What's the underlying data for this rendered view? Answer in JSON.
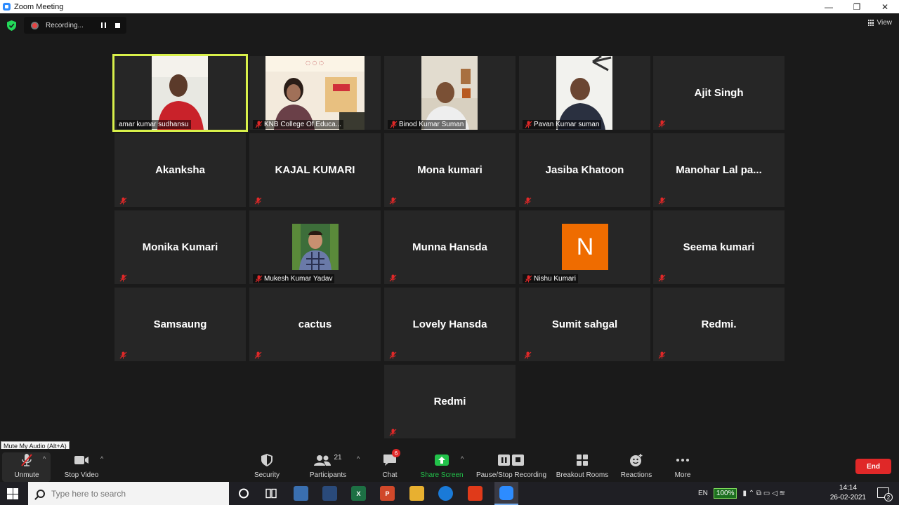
{
  "window": {
    "title": "Zoom Meeting",
    "controls": [
      "—",
      "❐",
      "✕"
    ]
  },
  "recording": {
    "status": "Recording..."
  },
  "view_button": {
    "label": "View"
  },
  "participants": [
    {
      "name": "amar kumar sudhansu",
      "video": true,
      "active": true
    },
    {
      "name": "KNB College Of Educa...",
      "video": true
    },
    {
      "name": "Binod Kumar Suman",
      "video": true
    },
    {
      "name": "Pavan Kumar suman",
      "video": true
    },
    {
      "name": "Ajit Singh",
      "video": false
    },
    {
      "name": "Akanksha",
      "video": false
    },
    {
      "name": "KAJAL KUMARI",
      "video": false
    },
    {
      "name": "Mona kumari",
      "video": false
    },
    {
      "name": "Jasiba Khatoon",
      "video": false
    },
    {
      "name": "Manohar Lal pa...",
      "video": false
    },
    {
      "name": "Monika Kumari",
      "video": false
    },
    {
      "name": "Mukesh Kumar Yadav",
      "video": true
    },
    {
      "name": "Munna Hansda",
      "video": false
    },
    {
      "name": "Nishu Kumari",
      "video": false,
      "avatar_letter": "N",
      "avatar_color": "#ef6c00"
    },
    {
      "name": "Seema kumari",
      "video": false
    },
    {
      "name": "Samsaung",
      "video": false
    },
    {
      "name": "cactus",
      "video": false
    },
    {
      "name": "Lovely Hansda",
      "video": false
    },
    {
      "name": "Sumit sahgal",
      "video": false
    },
    {
      "name": "Redmi.",
      "video": false
    },
    {
      "name": "Redmi",
      "video": false
    }
  ],
  "tooltip": "Mute My Audio (Alt+A)",
  "toolbar": {
    "unmute": "Unmute",
    "stop_video": "Stop Video",
    "security": "Security",
    "participants": "Participants",
    "participants_count": "21",
    "chat": "Chat",
    "chat_badge": "6",
    "share_screen": "Share Screen",
    "pause_stop_recording": "Pause/Stop Recording",
    "breakout_rooms": "Breakout Rooms",
    "reactions": "Reactions",
    "more": "More",
    "end": "End"
  },
  "colors": {
    "active_speaker": "#d8f04a",
    "share_green": "#22c24a",
    "end_red": "#e02828",
    "avatar_orange": "#ef6c00"
  },
  "taskbar": {
    "search_placeholder": "Type here to search",
    "language": "EN",
    "battery": "100%",
    "time": "14:14",
    "date": "26-02-2021",
    "notifications": "2"
  }
}
